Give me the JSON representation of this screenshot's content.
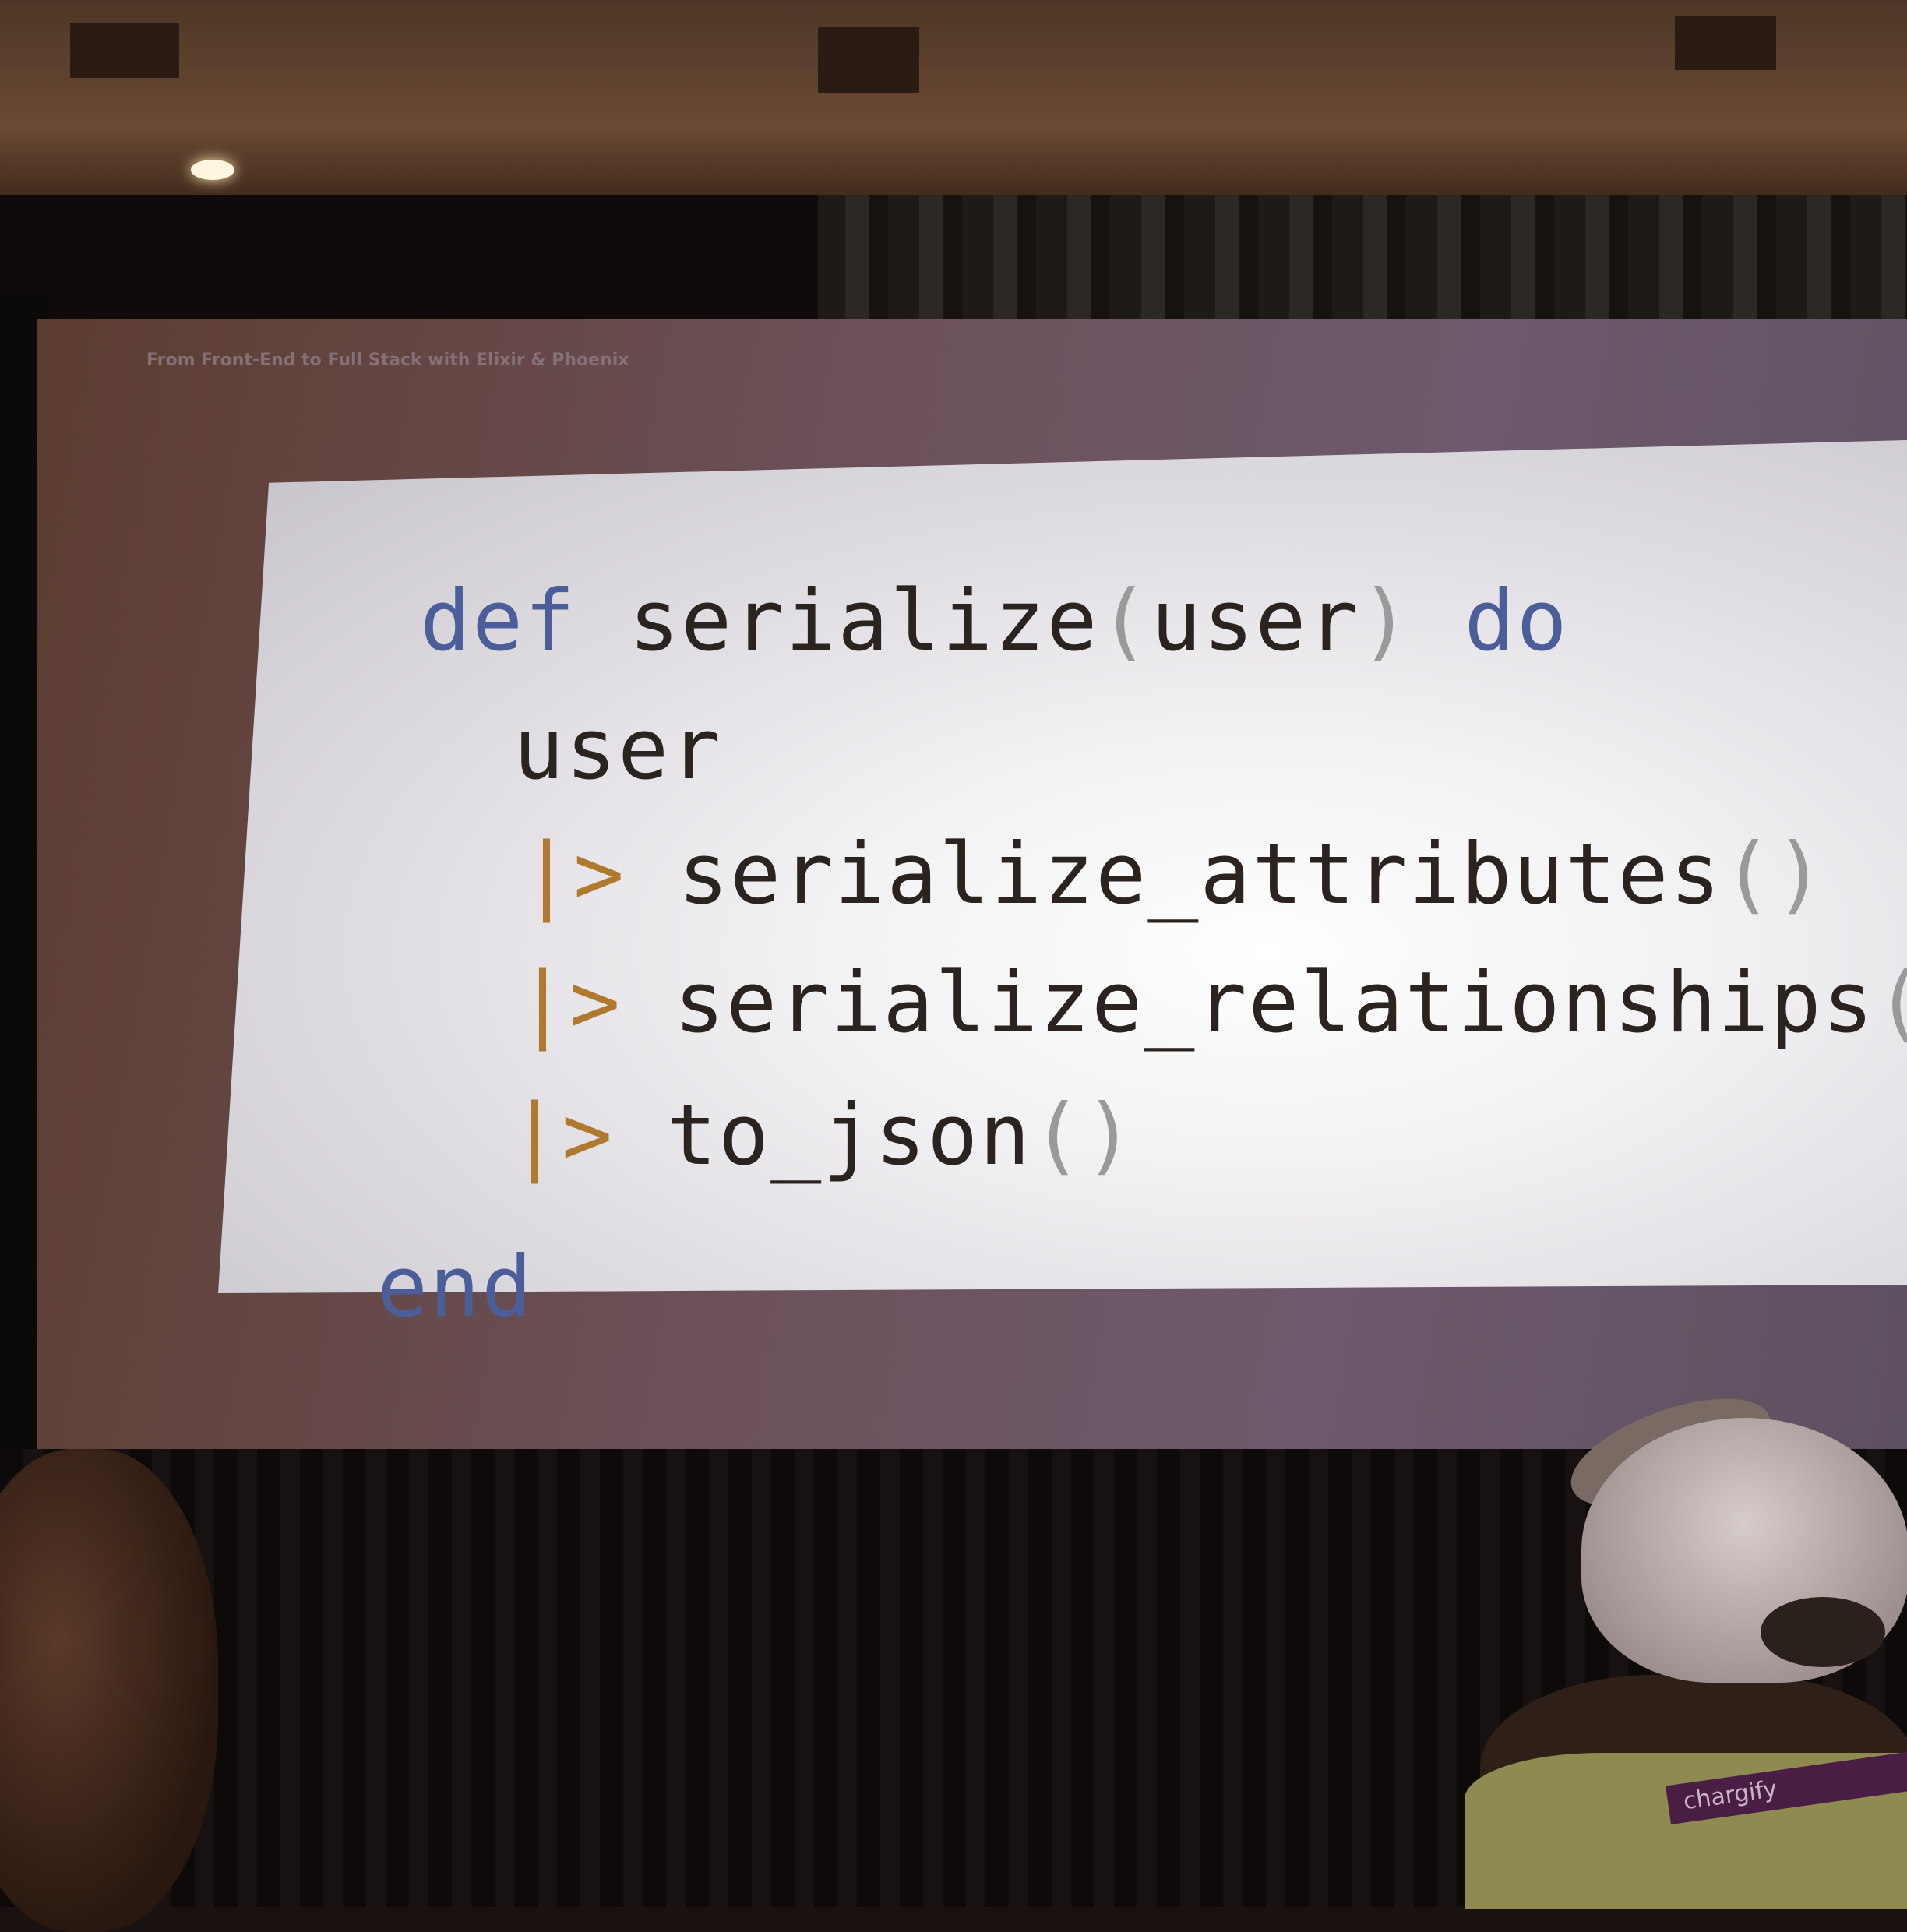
{
  "slide": {
    "title": "From Front-End to Full Stack with Elixir & Phoenix",
    "code": {
      "line1": {
        "kw_def": "def",
        "name": "serialize",
        "open": "(",
        "arg": "user",
        "close": ")",
        "kw_do": "do"
      },
      "line2": {
        "text": "user"
      },
      "line3": {
        "pipe": "|>",
        "call": "serialize_attributes",
        "parens": "()"
      },
      "line4": {
        "pipe": "|>",
        "call": "serialize_relationships",
        "parens": "()"
      },
      "line5": {
        "pipe": "|>",
        "call": "to_json",
        "parens": "()"
      },
      "line6": {
        "kw_end": "end"
      }
    }
  },
  "audience": {
    "lanyard_text": "chargify"
  },
  "colors": {
    "keyword": "#4c5e9a",
    "pipe": "#b07a2e",
    "paren": "#9a9a9a",
    "text": "#2a2320"
  }
}
